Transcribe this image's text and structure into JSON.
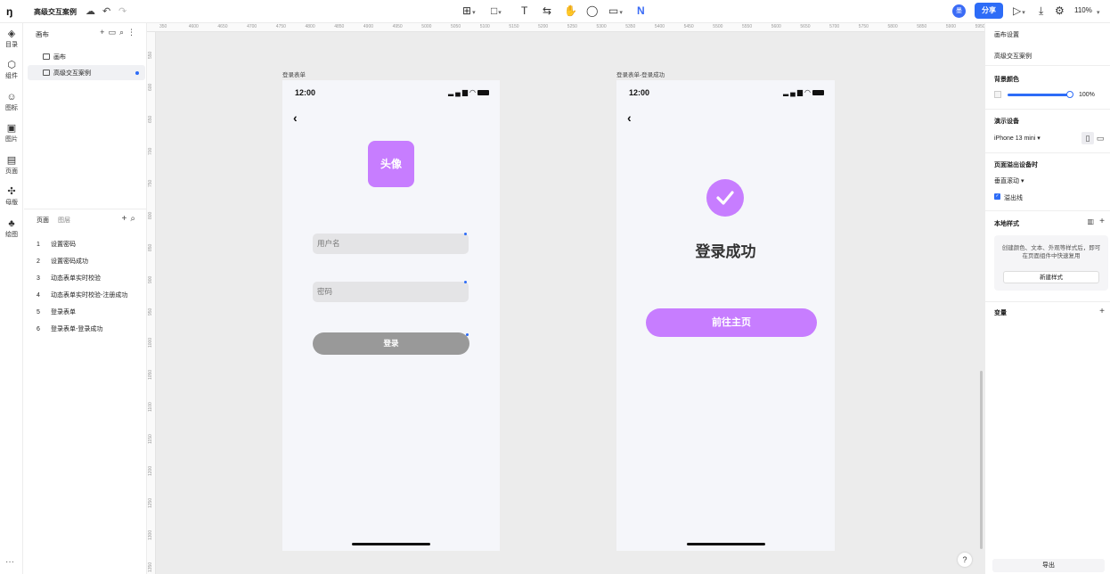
{
  "app": {
    "logo": "ŋ",
    "doc_name": "高级交互案例",
    "avatar_initial": "墨",
    "share_label": "分享",
    "zoom": "110%"
  },
  "rail": [
    {
      "icon": "layers-icon",
      "glyph": "◈",
      "label": "目录"
    },
    {
      "icon": "component-icon",
      "glyph": "⬡",
      "label": "组件"
    },
    {
      "icon": "emoji-icon",
      "glyph": "☺",
      "label": "图标"
    },
    {
      "icon": "image-icon",
      "glyph": "▣",
      "label": "图片"
    },
    {
      "icon": "page-icon",
      "glyph": "▤",
      "label": "页面"
    },
    {
      "icon": "master-icon",
      "glyph": "✣",
      "label": "母版"
    },
    {
      "icon": "drawing-icon",
      "glyph": "♣",
      "label": "绘图"
    }
  ],
  "left_panel": {
    "title": "画布",
    "canvases": [
      {
        "label": "画布",
        "selected": false
      },
      {
        "label": "高级交互案例",
        "selected": true
      }
    ],
    "tab_pages": "页面",
    "tab_layers": "图层",
    "pages": [
      {
        "num": "1",
        "label": "设置密码"
      },
      {
        "num": "2",
        "label": "设置密码成功"
      },
      {
        "num": "3",
        "label": "动态表单实时校验"
      },
      {
        "num": "4",
        "label": "动态表单实时校验-注册成功"
      },
      {
        "num": "5",
        "label": "登录表单"
      },
      {
        "num": "6",
        "label": "登录表单-登录成功"
      }
    ]
  },
  "ruler": {
    "top": [
      "350",
      "4600",
      "4650",
      "4700",
      "4750",
      "4800",
      "4850",
      "4900",
      "4950",
      "5000",
      "5050",
      "5100",
      "5150",
      "5200",
      "5250",
      "5300",
      "5350",
      "5400",
      "5450",
      "5500",
      "5550",
      "5600",
      "5650",
      "5700",
      "5750",
      "5800",
      "5850",
      "5900",
      "5950"
    ],
    "left": [
      "550",
      "600",
      "650",
      "700",
      "750",
      "800",
      "850",
      "900",
      "950",
      "1000",
      "1050",
      "1100",
      "1150",
      "1200",
      "1250",
      "1300",
      "1350"
    ]
  },
  "frame1": {
    "label": "登录表单",
    "time": "12:00",
    "avatar_text": "头像",
    "username_placeholder": "用户名",
    "password_placeholder": "密码",
    "login_label": "登录"
  },
  "frame2": {
    "label": "登录表单-登录成功",
    "time": "12:00",
    "success_text": "登录成功",
    "home_button": "前往主页"
  },
  "right_panel": {
    "canvas_settings": "画布设置",
    "canvas_name": "高级交互案例",
    "bg_color_label": "背景颜色",
    "bg_opacity": "100%",
    "device_label": "演示设备",
    "device_value": "iPhone 13 mini",
    "overflow_label": "页面溢出设备时",
    "overflow_value": "垂直滚动",
    "overflow_check_label": "溢出线",
    "local_styles": "本地样式",
    "styles_desc": "创建颜色、文本、外观等样式后，即可在页面组件中快速复用",
    "new_style": "新建样式",
    "variables": "变量",
    "export": "导出"
  },
  "help": "?",
  "colors": {
    "accent": "#2d6cf7",
    "purple": "#c77dff",
    "disabled_btn": "#999999"
  }
}
